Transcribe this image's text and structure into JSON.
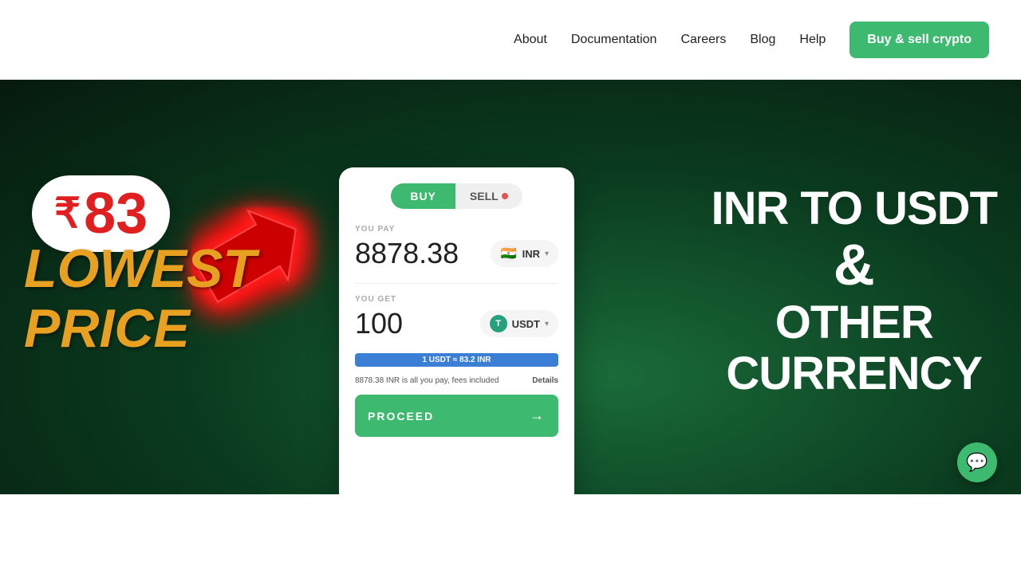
{
  "navbar": {
    "links": [
      {
        "label": "About",
        "id": "about"
      },
      {
        "label": "Documentation",
        "id": "documentation"
      },
      {
        "label": "Careers",
        "id": "careers"
      },
      {
        "label": "Blog",
        "id": "blog"
      },
      {
        "label": "Help",
        "id": "help"
      }
    ],
    "cta_label": "Buy & sell crypto"
  },
  "hero": {
    "badge": {
      "symbol": "₹",
      "number": "83"
    },
    "left_text": {
      "line1": "LOWEST",
      "line2": "PRICE"
    },
    "right_text": {
      "line1": "INR TO USDT",
      "line2": "&",
      "line3": "OTHER",
      "line4": "CURRENCY"
    }
  },
  "card": {
    "tab_buy": "BUY",
    "tab_sell": "SELL",
    "you_pay_label": "YOU PAY",
    "you_pay_value": "8878.38",
    "you_pay_currency": "INR",
    "you_get_label": "YOU GET",
    "you_get_value": "100",
    "you_get_currency": "USDT",
    "rate_text": "1 USDT ≈ 83.2 INR",
    "fee_text": "8878.38 INR is all you pay, fees included",
    "details_label": "Details",
    "proceed_label": "PROCEED"
  },
  "chat": {
    "icon": "💬"
  }
}
